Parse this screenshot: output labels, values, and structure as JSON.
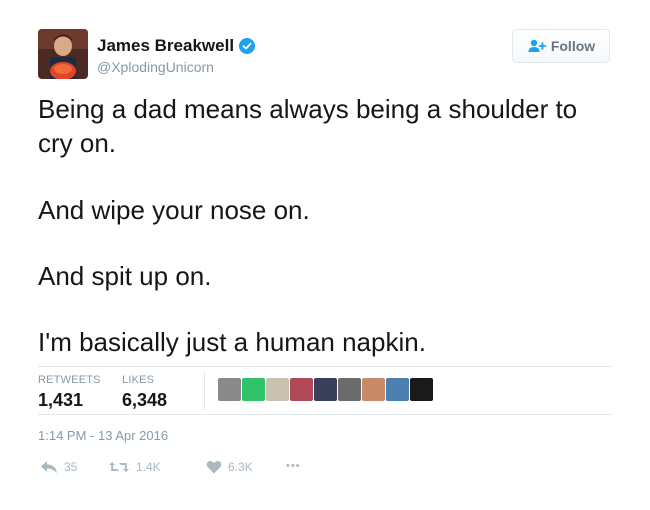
{
  "author": {
    "name": "James Breakwell",
    "handle": "@XplodingUnicorn",
    "verified": true
  },
  "follow_button": {
    "label": "Follow",
    "icon": "add-person-icon"
  },
  "tweet": {
    "lines": [
      "Being a dad means always being a shoulder to",
      "cry on.",
      "And wipe your nose on.",
      "And spit up on.",
      "I'm basically just a human napkin."
    ]
  },
  "stats": {
    "retweets_label": "RETWEETS",
    "retweets_value": "1,431",
    "likes_label": "LIKES",
    "likes_value": "6,348"
  },
  "likers": [
    {
      "name": "liker-avatar",
      "color": "#8a8a8a"
    },
    {
      "name": "liker-avatar",
      "color": "#2fc36a"
    },
    {
      "name": "liker-avatar",
      "color": "#c9c2b0"
    },
    {
      "name": "liker-avatar",
      "color": "#b04a5a"
    },
    {
      "name": "liker-avatar",
      "color": "#3a3f5a"
    },
    {
      "name": "liker-avatar",
      "color": "#6b6b6b"
    },
    {
      "name": "liker-avatar",
      "color": "#c98a6a"
    },
    {
      "name": "liker-avatar",
      "color": "#4a7fb0"
    },
    {
      "name": "liker-avatar",
      "color": "#1a1a1a"
    }
  ],
  "timestamp": "1:14 PM - 13 Apr 2016",
  "actions": {
    "reply_count": "35",
    "retweet_count": "1.4K",
    "like_count": "6.3K",
    "more": "•••"
  },
  "colors": {
    "verified_blue": "#1da1f2",
    "muted_text": "#8899a6",
    "icon_gray": "#aab8c2"
  }
}
